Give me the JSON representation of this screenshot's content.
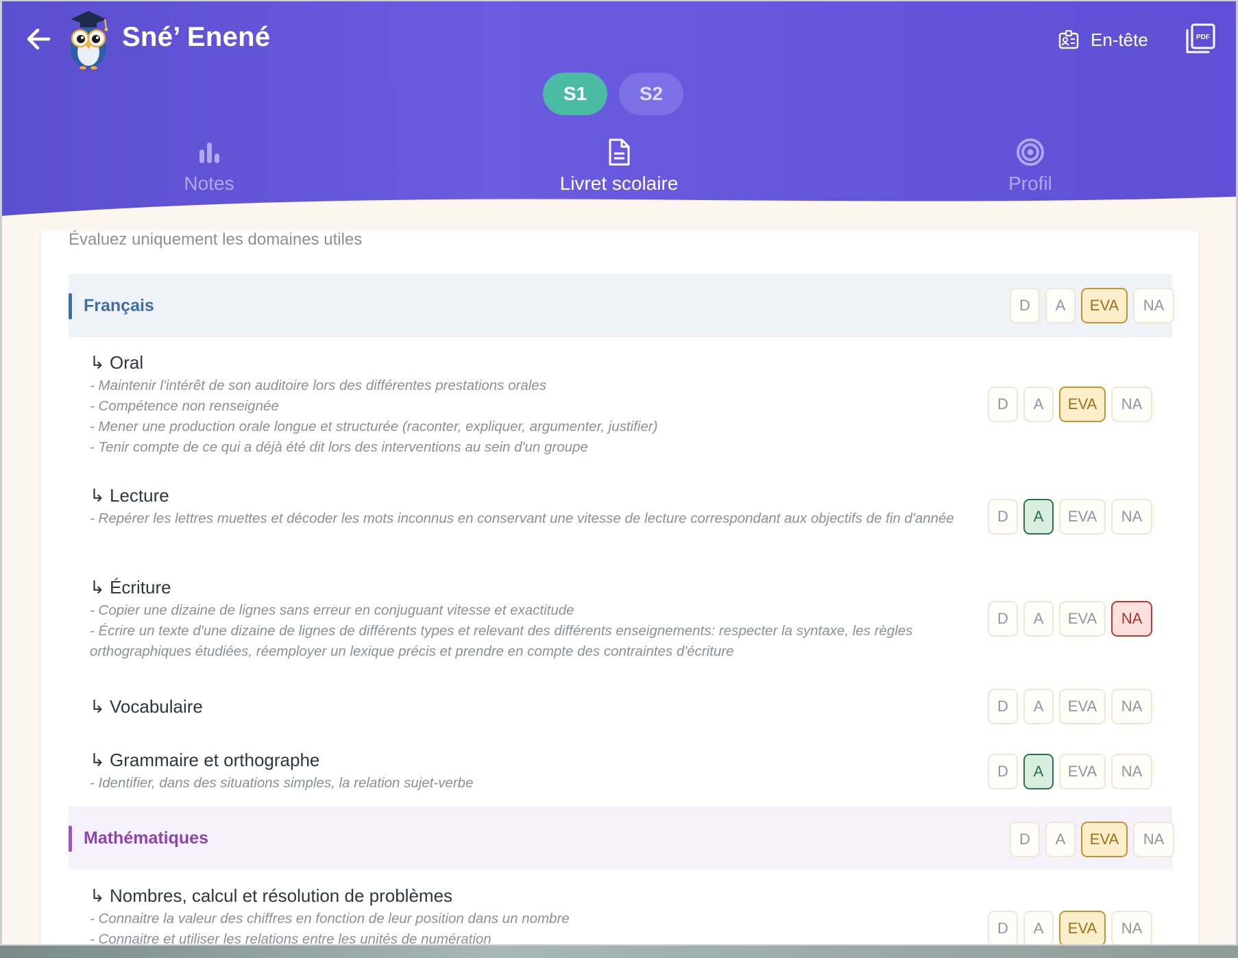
{
  "header": {
    "student_name": "Sné’ Enené",
    "entete_label": "En-tête",
    "semesters": [
      "S1",
      "S2"
    ],
    "active_semester": "S1",
    "tabs": [
      {
        "label": "Notes",
        "icon": "bar-chart-icon",
        "active": false
      },
      {
        "label": "Livret scolaire",
        "icon": "document-icon",
        "active": true
      },
      {
        "label": "Profil",
        "icon": "target-icon",
        "active": false
      }
    ]
  },
  "colors": {
    "header_bg": "#5e52d8",
    "s1_active": "#4cbba3",
    "francais_accent": "#3f6f9e",
    "maths_accent": "#8e44ad",
    "eva_selected": "#c4932e",
    "a_selected": "#2f6f4a",
    "na_selected": "#c0392b"
  },
  "grade_labels": {
    "d": "D",
    "a": "A",
    "eva": "EVA",
    "na": "NA"
  },
  "content": {
    "hint": "Évaluez uniquement les domaines utiles",
    "domains": [
      {
        "title": "Français",
        "selected": "EVA",
        "subs": [
          {
            "title": "↳ Oral",
            "desc": [
              "- Maintenir l'intérêt de son auditoire lors des différentes prestations orales",
              "- Compétence non renseignée",
              "- Mener une production orale longue et structurée (raconter, expliquer, argumenter, justifier)",
              "- Tenir compte de ce qui a déjà été dit lors des interventions au sein d'un groupe"
            ],
            "selected": "EVA"
          },
          {
            "title": "↳ Lecture",
            "desc": [
              "- Repérer les lettres muettes et décoder les mots inconnus en conservant une vitesse de lecture correspondant aux objectifs de fin d'année"
            ],
            "selected": "A"
          },
          {
            "title": "↳ Écriture",
            "desc": [
              "- Copier une dizaine de lignes sans erreur en conjuguant vitesse et exactitude",
              "- Écrire un texte d'une dizaine de lignes de différents types et relevant des différents enseignements: respecter la syntaxe, les règles orthographiques étudiées, réemployer un lexique précis et prendre en compte des contraintes d'écriture"
            ],
            "selected": "NA"
          },
          {
            "title": "↳ Vocabulaire",
            "desc": [],
            "selected": ""
          },
          {
            "title": "↳ Grammaire et orthographe",
            "desc": [
              "- Identifier, dans des situations simples, la relation sujet-verbe"
            ],
            "selected": "A"
          }
        ]
      },
      {
        "title": "Mathématiques",
        "selected": "EVA",
        "subs": [
          {
            "title": "↳ Nombres, calcul et résolution de problèmes",
            "desc": [
              "- Connaitre la valeur des chiffres en fonction de leur position dans un nombre",
              "- Connaitre et utiliser les relations entre les unités de numération"
            ],
            "selected": "EVA"
          }
        ]
      }
    ]
  }
}
